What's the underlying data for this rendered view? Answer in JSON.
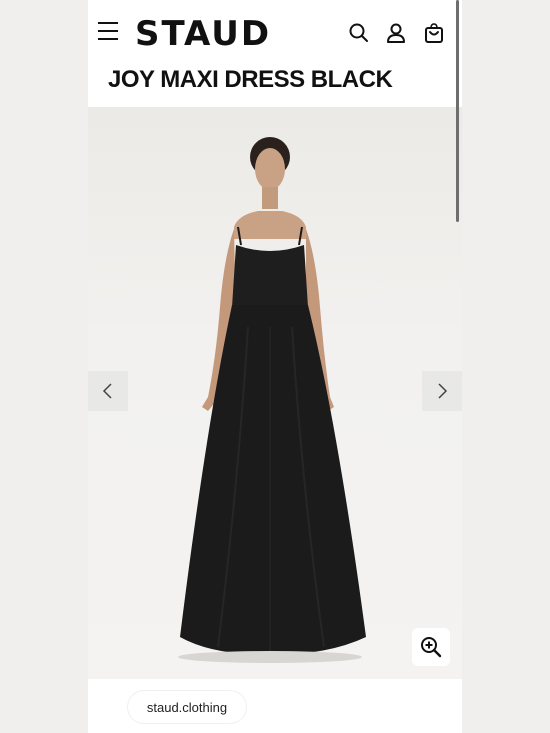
{
  "header": {
    "logo": "STAUD",
    "icons": [
      "menu-icon",
      "search-icon",
      "account-icon",
      "bag-icon"
    ]
  },
  "product": {
    "title": "JOY MAXI DRESS BLACK"
  },
  "gallery": {
    "prev_icon": "chevron-left-icon",
    "next_icon": "chevron-right-icon",
    "zoom_icon": "zoom-in-icon"
  },
  "footer": {
    "source_label": "staud.clothing"
  },
  "colors": {
    "text": "#111111",
    "dress": "#1b1b1b",
    "background": "#efeeec"
  }
}
